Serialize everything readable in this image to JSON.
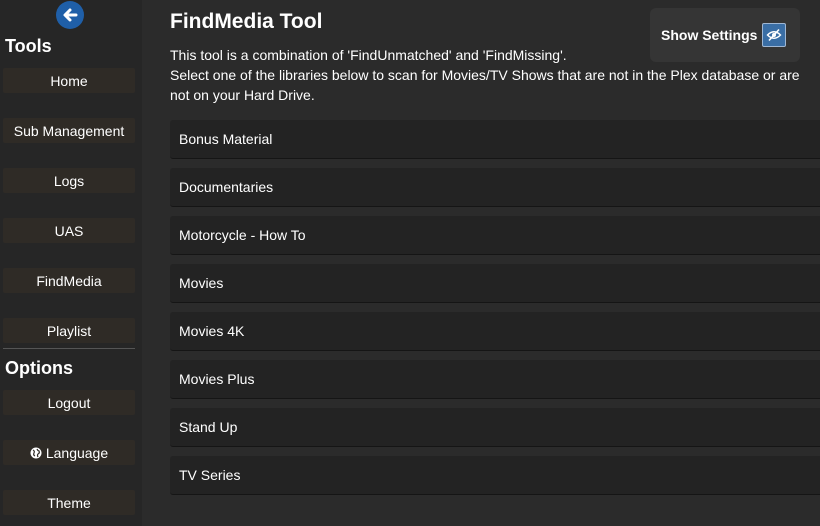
{
  "sidebar": {
    "tools_heading": "Tools",
    "options_heading": "Options",
    "tools": [
      {
        "label": "Home"
      },
      {
        "label": "Sub Management"
      },
      {
        "label": "Logs"
      },
      {
        "label": "UAS"
      },
      {
        "label": "FindMedia"
      },
      {
        "label": "Playlist"
      }
    ],
    "options": [
      {
        "label": "Logout"
      },
      {
        "label": "Language",
        "icon": "globe-icon"
      },
      {
        "label": "Theme"
      }
    ]
  },
  "main": {
    "title": "FindMedia Tool",
    "description_line1": "This tool is a combination of 'FindUnmatched' and 'FindMissing'.",
    "description_line2": "Select one of the libraries below to scan for Movies/TV Shows that are not in the Plex database or are not on your Hard Drive.",
    "settings_label": "Show Settings",
    "libraries": [
      "Bonus Material",
      "Documentaries",
      "Motorcycle - How To",
      "Movies",
      "Movies 4K",
      "Movies Plus",
      "Stand Up",
      "TV Series"
    ]
  },
  "colors": {
    "accent": "#1f5fa8",
    "sidebar_bg": "#262626",
    "button_bg": "#2f2b26",
    "list_item_bg": "#232323"
  }
}
